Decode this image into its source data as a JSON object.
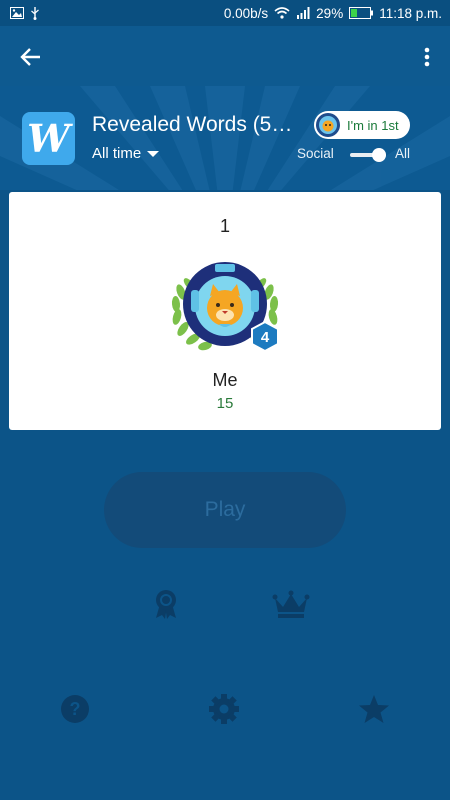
{
  "status_bar": {
    "network_speed": "0.00b/s",
    "battery": "29%",
    "time": "11:18 p.m."
  },
  "app_bar": {
    "back_icon": "arrow-left-icon",
    "menu_icon": "more-vertical-icon"
  },
  "leaderboard": {
    "app_icon_letter": "W",
    "title": "Revealed Words (5…",
    "time_filter": "All time",
    "rank_pill": "I'm in 1st",
    "toggle_left_label": "Social",
    "toggle_right_label": "All",
    "toggle_state": "All"
  },
  "entry": {
    "rank": "1",
    "player_level": "4",
    "player_name": "Me",
    "score": "15"
  },
  "play_button": {
    "label": "Play"
  },
  "bottom_icons": {
    "row1": [
      "achievements-ribbon-icon",
      "leaderboard-crown-icon"
    ],
    "row2": [
      "help-icon",
      "settings-gear-icon",
      "rate-star-icon"
    ]
  },
  "colors": {
    "background": "#0c5488",
    "card": "#ffffff",
    "score_green": "#2a7a3a",
    "badge_blue": "#1d7bc0",
    "play_button": "#134b79"
  }
}
